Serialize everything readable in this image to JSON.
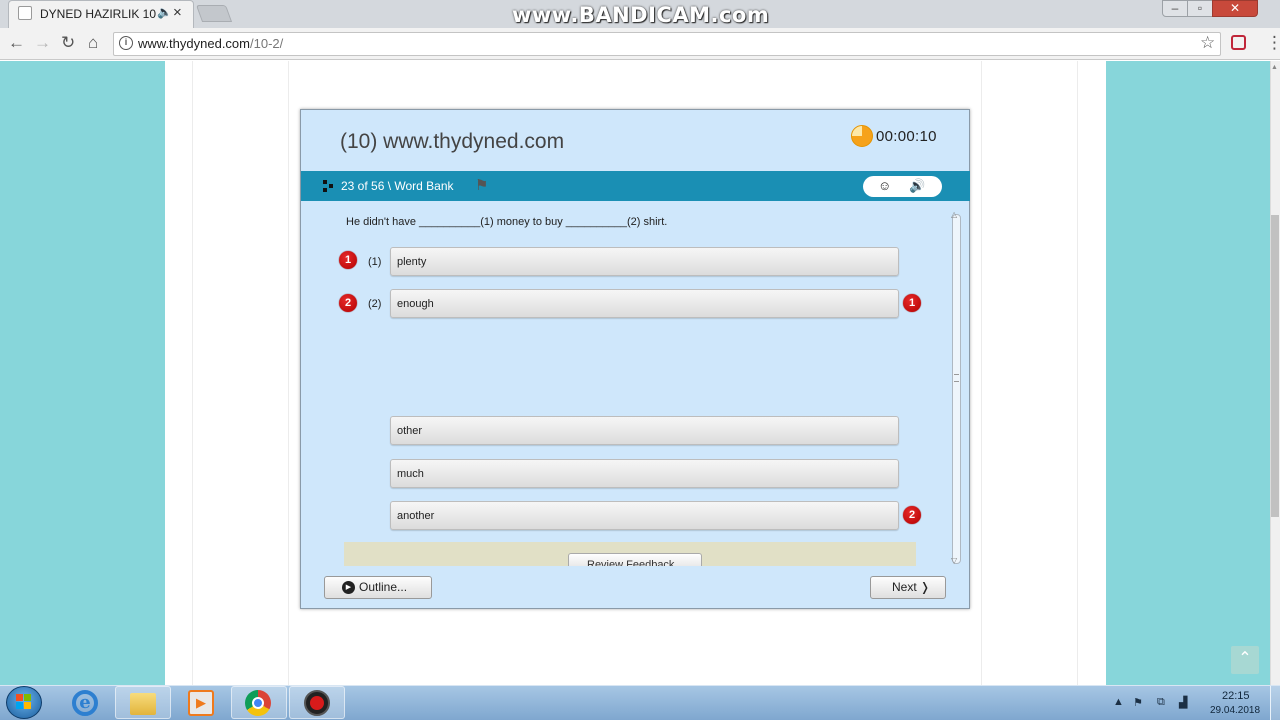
{
  "browser": {
    "tab_title": "DYNED HAZIRLIK 10",
    "watermark": "www.BANDICAM.com",
    "url_host": "www.thydyned.com",
    "url_path": "/10-2/"
  },
  "icons": {
    "audio": "speaker-icon",
    "close": "close-icon",
    "back": "arrow-left-icon",
    "forward": "arrow-right-icon",
    "reload": "reload-icon",
    "home": "home-icon",
    "info": "info-icon",
    "star": "star-icon",
    "menu": "menu-icon"
  },
  "quiz": {
    "title": "(10) www.thydyned.com",
    "timer": "00:00:10",
    "progress": "23 of 56 \\ Word Bank",
    "prompt": "He didn't have __________(1) money to buy __________(2) shirt.",
    "slots": [
      {
        "badge": "1",
        "label": "(1)",
        "answer": "plenty"
      },
      {
        "badge": "2",
        "label": "(2)",
        "answer": "enough",
        "marker": "1"
      }
    ],
    "word_bank": [
      {
        "word": "other"
      },
      {
        "word": "much"
      },
      {
        "word": "another",
        "marker": "2"
      }
    ],
    "review_button": "Review Feedback",
    "outline_button": "Outline...",
    "next_button": "Next ❭"
  },
  "taskbar": {
    "clock_time": "22:15",
    "clock_date": "29.04.2018"
  },
  "colors": {
    "page_background": "#87d6da",
    "quiz_background": "#cfe7fb",
    "quiz_bar": "#1a8fb4",
    "badge_red": "#d40000",
    "timer_orange": "#f6a21a"
  }
}
